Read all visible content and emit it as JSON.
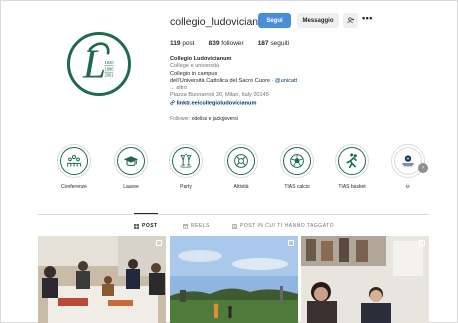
{
  "profile": {
    "username": "collegio_ludovicianum",
    "follow_label": "Segui",
    "message_label": "Messaggio",
    "add_user_icon": "add-user-icon",
    "more_icon": "more-icon",
    "avatar_years": [
      "1920",
      "1990",
      "2001"
    ]
  },
  "stats": {
    "posts_count": "119",
    "posts_label": "post",
    "followers_count": "839",
    "followers_label": "follower",
    "following_count": "187",
    "following_label": "seguiti"
  },
  "bio": {
    "name": "Collegio Ludovicianum",
    "category": "College e università",
    "line1": "Collegio in campus",
    "line2_text": "dell'Università Cattolica del Sacro Cuore · ",
    "line2_mention": "@unicatt",
    "line3": "... altro",
    "address": "Piazza Buonarroti 30, Milan, Italy 20145",
    "link": "linktr.ee/collegioludovicianum",
    "followers_prefix": "Follower: ",
    "followers_names": "odeliss e jackgoversi"
  },
  "highlights": [
    {
      "label": "Conferenze",
      "icon": "people-icon"
    },
    {
      "label": "Lauree",
      "icon": "graduation-cap-icon"
    },
    {
      "label": "Party",
      "icon": "party-icon"
    },
    {
      "label": "Attività",
      "icon": "activities-icon"
    },
    {
      "label": "TIAS calcio",
      "icon": "soccer-ball-icon"
    },
    {
      "label": "TIAS basket",
      "icon": "basketball-player-icon"
    },
    {
      "label": "💀",
      "icon": "festival-logo-icon"
    }
  ],
  "tabs": [
    {
      "label": "POST",
      "icon": "grid-icon",
      "active": true
    },
    {
      "label": "REELS",
      "icon": "reels-icon",
      "active": false
    },
    {
      "label": "POST IN CUI TI HANNO TAGGATO",
      "icon": "tagged-icon",
      "active": false
    }
  ],
  "colors": {
    "brand_green": "#1e6b4c",
    "follow_blue": "#4a8ed7"
  }
}
